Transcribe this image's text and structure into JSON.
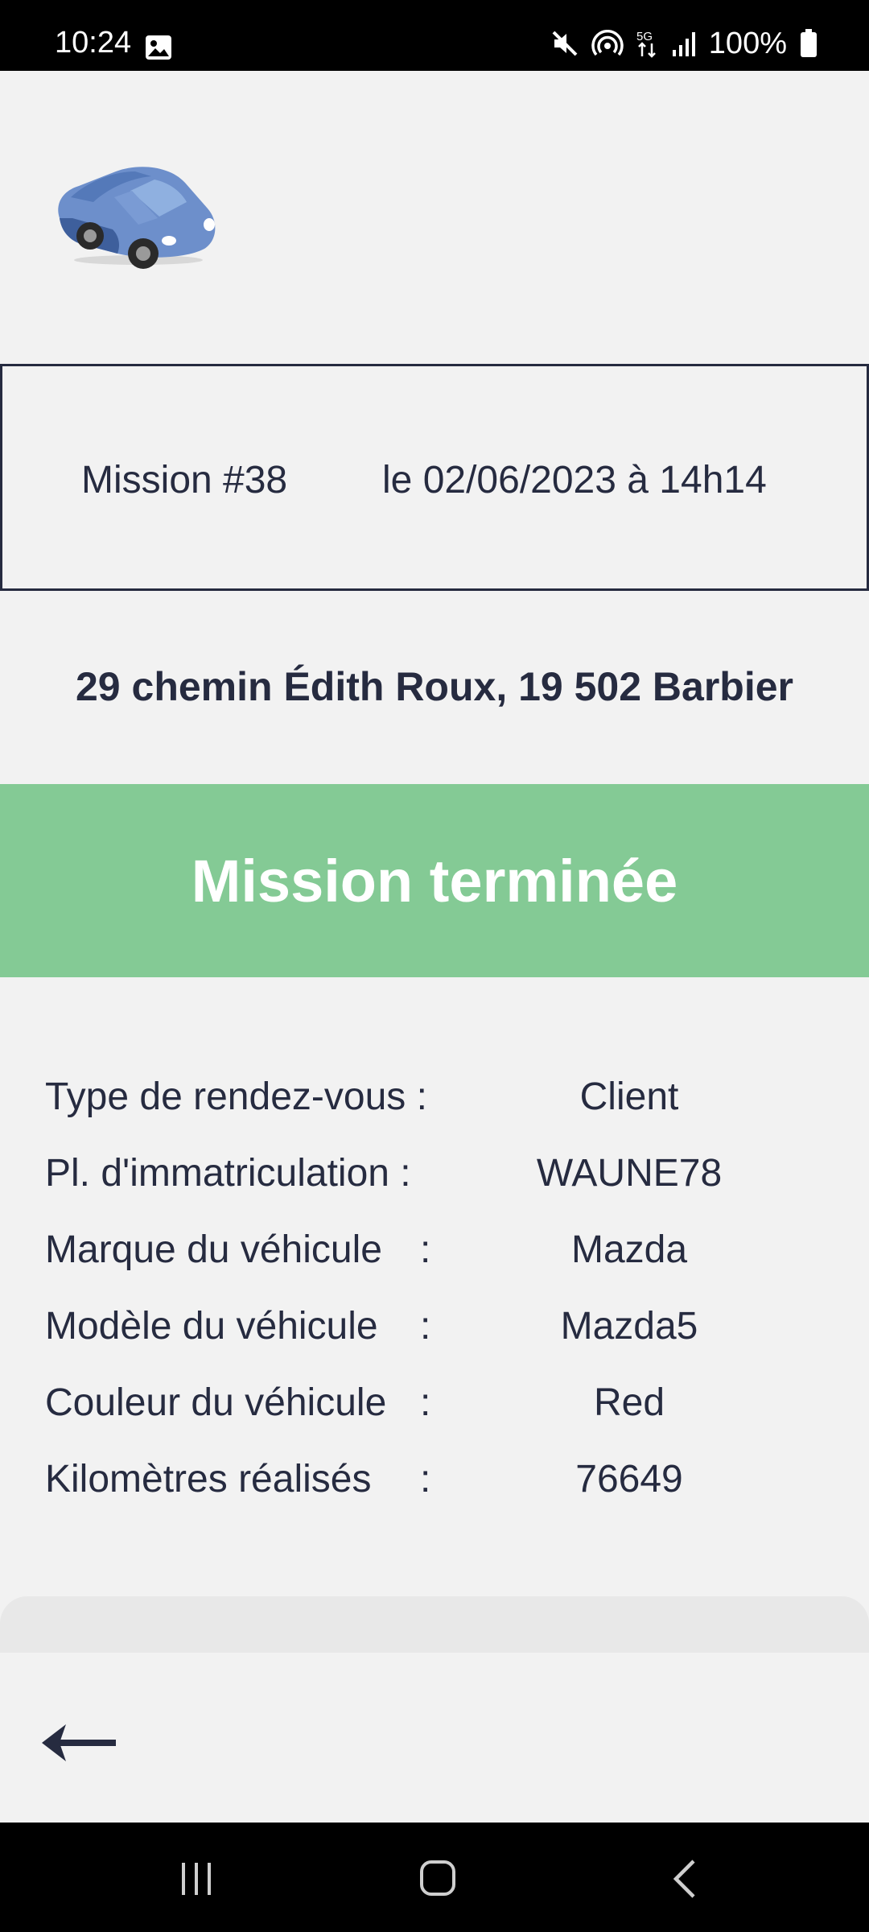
{
  "status_bar": {
    "time": "10:24",
    "battery": "100%",
    "icons": [
      "gallery-icon",
      "mute-icon",
      "hotspot-icon",
      "5g-icon",
      "signal-icon",
      "battery-icon"
    ]
  },
  "logo": {
    "icon": "car-icon"
  },
  "mission": {
    "number": "Mission #38",
    "date": "le 02/06/2023 à 14h14"
  },
  "address": "29 chemin Édith Roux, 19 502 Barbier",
  "status": {
    "label": "Mission terminée",
    "color": "#84ca95"
  },
  "details": [
    {
      "label": "Type de rendez-vous :",
      "colon": "",
      "value": "Client"
    },
    {
      "label": "Pl. d'immatriculation :",
      "colon": "",
      "value": "WAUNE78"
    },
    {
      "label": "Marque du véhicule",
      "colon": ":",
      "value": "Mazda"
    },
    {
      "label": "Modèle du véhicule",
      "colon": ":",
      "value": "Mazda5"
    },
    {
      "label": "Couleur du véhicule",
      "colon": ":",
      "value": "Red"
    },
    {
      "label": "Kilomètres réalisés",
      "colon": ":",
      "value": "76649"
    }
  ],
  "navigation": {
    "back_icon": "arrow-left-icon",
    "system": [
      "recents-icon",
      "home-icon",
      "back-icon"
    ]
  },
  "colors": {
    "text": "#262b40",
    "background": "#f2f2f2",
    "banner": "#84ca95"
  }
}
